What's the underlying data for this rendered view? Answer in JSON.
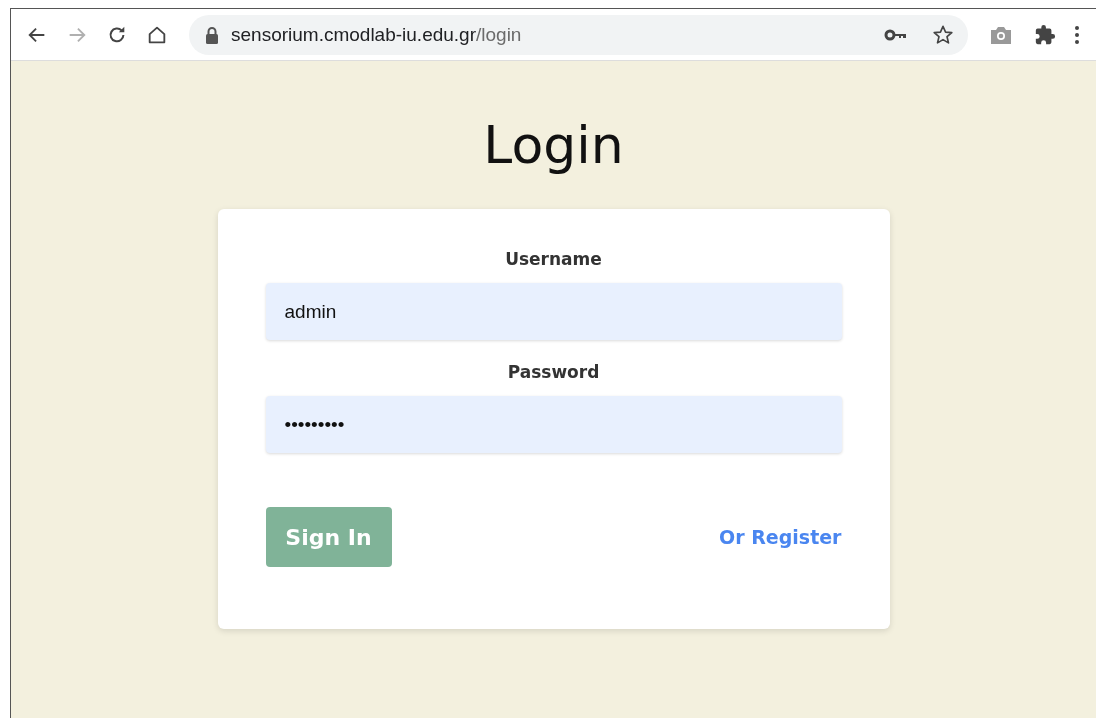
{
  "browser": {
    "nav_buttons": [
      {
        "kind": "back",
        "disabled": false
      },
      {
        "kind": "forward",
        "disabled": true
      },
      {
        "kind": "reload",
        "disabled": false
      },
      {
        "kind": "home",
        "disabled": false
      }
    ],
    "address": {
      "host": "sensorium.cmodlab-iu.edu.gr",
      "path": "/login"
    }
  },
  "page": {
    "title": "Login",
    "fields": [
      {
        "label": "Username",
        "value": "admin"
      },
      {
        "label": "Password",
        "value": "•••••••••"
      }
    ],
    "submit": "Sign In",
    "register_link": "Or Register"
  }
}
